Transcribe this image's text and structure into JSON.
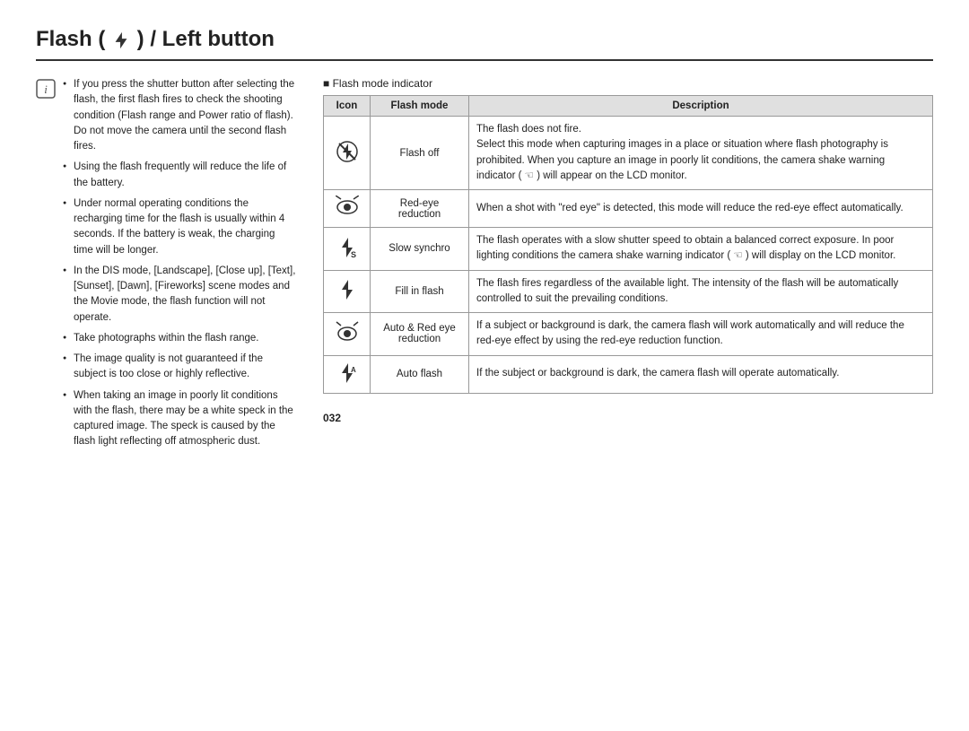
{
  "title": "Flash (  ) / Left button",
  "title_plain": "Flash ( ⚡ ) / Left button",
  "note": {
    "bullets": [
      "If you press the shutter button after selecting the flash, the first flash fires to check the shooting condition (Flash range and Power ratio of flash). Do not move the camera until the second flash fires.",
      "Using the flash frequently will reduce the life of the battery.",
      "Under normal operating conditions the recharging time for the flash is usually within 4 seconds. If the battery is weak, the charging time will be longer.",
      "In the DIS mode, [Landscape], [Close up], [Text], [Sunset], [Dawn], [Fireworks] scene modes and the Movie mode, the flash function will not operate.",
      "Take photographs within the flash range.",
      "The image quality is not guaranteed if the subject is too close or highly reflective.",
      "When taking an image in poorly lit conditions with the flash, there may be a white speck in the captured image. The speck is caused by the flash light reflecting off atmospheric dust."
    ]
  },
  "indicator_label": "Flash mode indicator",
  "table": {
    "headers": [
      "Icon",
      "Flash mode",
      "Description"
    ],
    "rows": [
      {
        "icon": "flash-off",
        "mode": "Flash off",
        "description": "The flash does not fire.\nSelect this mode when capturing images in a place or situation where flash photography is prohibited. When you capture an image in poorly lit conditions, the camera shake warning indicator ( ☜ ) will appear on the LCD monitor."
      },
      {
        "icon": "red-eye",
        "mode": "Red-eye reduction",
        "description": "When a shot with \"red eye\" is detected, this mode will reduce the red-eye effect automatically."
      },
      {
        "icon": "slow-synchro",
        "mode": "Slow synchro",
        "description": "The flash operates with a slow shutter speed to obtain a balanced correct exposure. In poor lighting conditions the camera shake warning indicator ( ☜ ) will display on the LCD monitor."
      },
      {
        "icon": "fill-flash",
        "mode": "Fill in flash",
        "description": "The flash fires regardless of the available light. The intensity of the flash will be automatically controlled to suit the prevailing conditions."
      },
      {
        "icon": "auto-red-eye",
        "mode": "Auto & Red eye reduction",
        "description": "If a subject or background is dark, the camera flash will work automatically and will reduce the red-eye effect by using the red-eye reduction function."
      },
      {
        "icon": "auto-flash",
        "mode": "Auto flash",
        "description": "If the subject or background is dark, the camera flash will operate automatically."
      }
    ]
  },
  "page_number": "032"
}
